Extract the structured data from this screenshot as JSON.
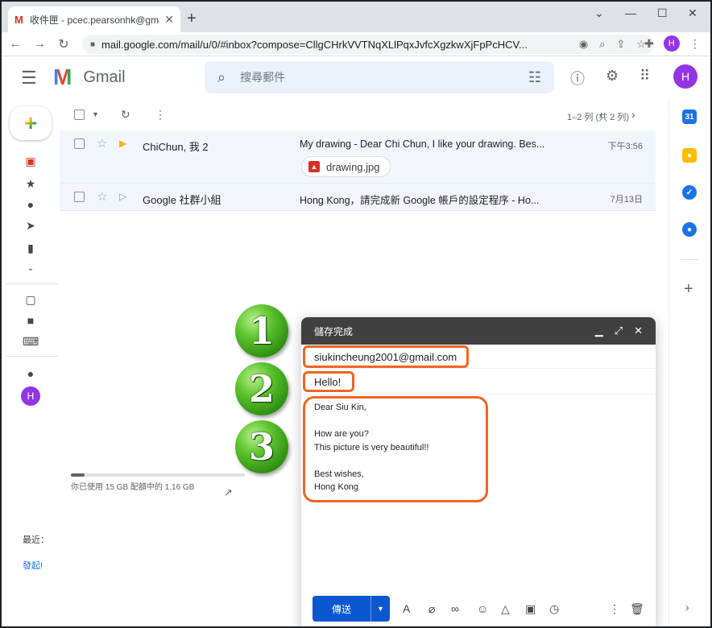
{
  "browser": {
    "tab_title": "收件匣 - pcec.pearsonhk@gma",
    "url": "mail.google.com/mail/u/0/#inbox?compose=CllgCHrkVVTNqXLlPqxJvfcXgzkwXjFpPcHCV...",
    "profile_initial": "H"
  },
  "gmail": {
    "app_name": "Gmail",
    "search_placeholder": "搜尋郵件",
    "account_initial": "H",
    "pager": "1–2 列 (共 2 列)"
  },
  "emails": [
    {
      "sender": "ChiChun, 我 2",
      "subject": "My drawing - Dear Chi Chun, I like your drawing. Bes...",
      "date": "下午3:56",
      "attachment": "drawing.jpg",
      "important": true
    },
    {
      "sender": "Google 社群小組",
      "subject": "Hong Kong，請完成新 Google 帳戶的設定程序 - Ho...",
      "date": "7月13日",
      "important": false
    }
  ],
  "storage": {
    "text": "你已使用 15 GB 配額中的 1.16 GB",
    "used_fraction": 0.08
  },
  "left_footer": {
    "recent": "最近：",
    "start": "發起!"
  },
  "compose": {
    "title": "儲存完成",
    "to": "siukincheung2001@gmail.com",
    "subject": "Hello!",
    "body": "Dear Siu Kin,\n\nHow are you?\nThis picture is very beautiful!!\n\nBest wishes,\nHong Kong",
    "send_label": "傳送"
  },
  "steps": [
    "1",
    "2",
    "3"
  ],
  "colors": {
    "highlight": "#f26522",
    "send_button": "#0b57d0",
    "compose_header": "#404040",
    "avatar": "#9334e6",
    "badge_green": "#3aa316"
  }
}
